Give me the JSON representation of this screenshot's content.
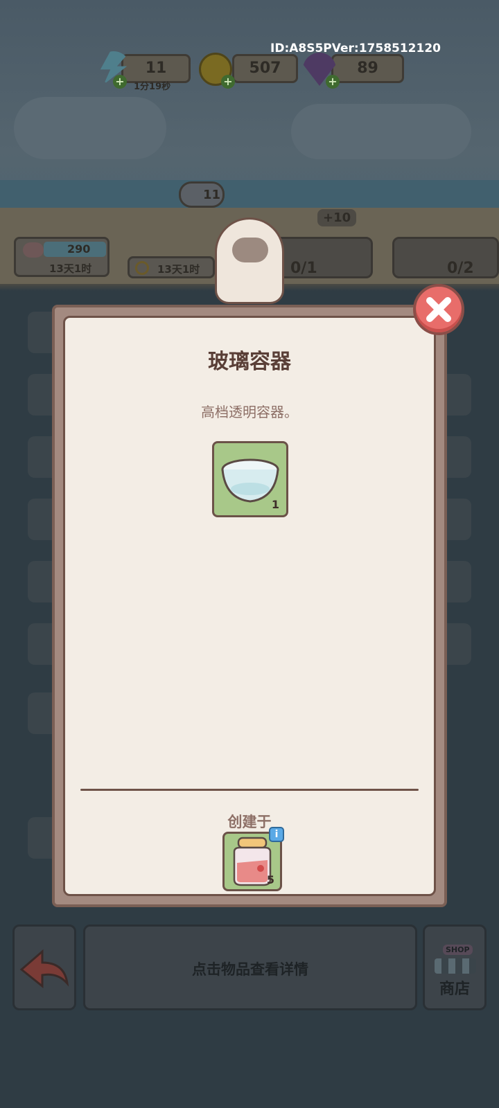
{
  "header": {
    "id_version": "ID:A8S5PVer:1758512120",
    "energy": {
      "value": "11",
      "timer": "1分19秒",
      "icon": "lightning-icon"
    },
    "coins": {
      "value": "507",
      "icon": "coin-icon"
    },
    "gems": {
      "value": "89",
      "icon": "gem-icon"
    }
  },
  "stations": {
    "left": {
      "value": "290",
      "timer": "13天1时"
    },
    "middle": {
      "timer": "13天1时",
      "bubble": "11"
    },
    "order1": {
      "bonus": "+10",
      "count": "0/1"
    },
    "order2": {
      "count": "0/2"
    }
  },
  "modal": {
    "title": "玻璃容器",
    "description": "高档透明容器。",
    "item_count": "1",
    "created_label": "创建于",
    "source_count": "5",
    "info_badge": "i"
  },
  "footer": {
    "hint": "点击物品查看详情",
    "shop_label": "商店",
    "shop_sign": "SHOP"
  },
  "colors": {
    "close_button": "#e86d6a",
    "item_card": "#a8c889",
    "modal_bg": "#f3ede5",
    "title_text": "#5a3f37"
  }
}
